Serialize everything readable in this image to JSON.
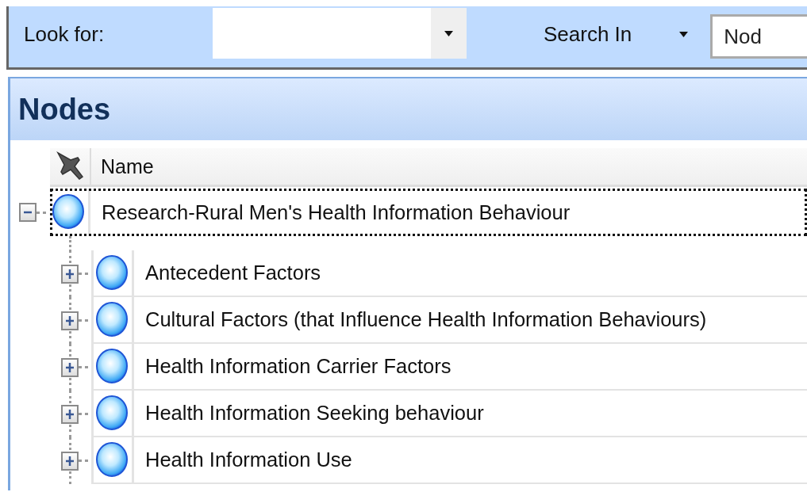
{
  "toolbar": {
    "look_for_label": "Look for:",
    "search_in_button": "Search In",
    "search_in_value": "Nod"
  },
  "panel": {
    "title": "Nodes",
    "columns": [
      "Name"
    ],
    "tree": [
      {
        "name": "Research-Rural Men's Health Information Behaviour",
        "expanded": true,
        "selected": true,
        "children": [
          {
            "name": "Antecedent Factors",
            "expanded": false,
            "selected": false
          },
          {
            "name": "Cultural Factors (that Influence Health Information Behaviours)",
            "expanded": false,
            "selected": false
          },
          {
            "name": "Health Information Carrier Factors",
            "expanded": false,
            "selected": false
          },
          {
            "name": "Health Information Seeking behaviour",
            "expanded": false,
            "selected": false
          },
          {
            "name": "Health Information Use",
            "expanded": false,
            "selected": false
          }
        ]
      }
    ]
  }
}
